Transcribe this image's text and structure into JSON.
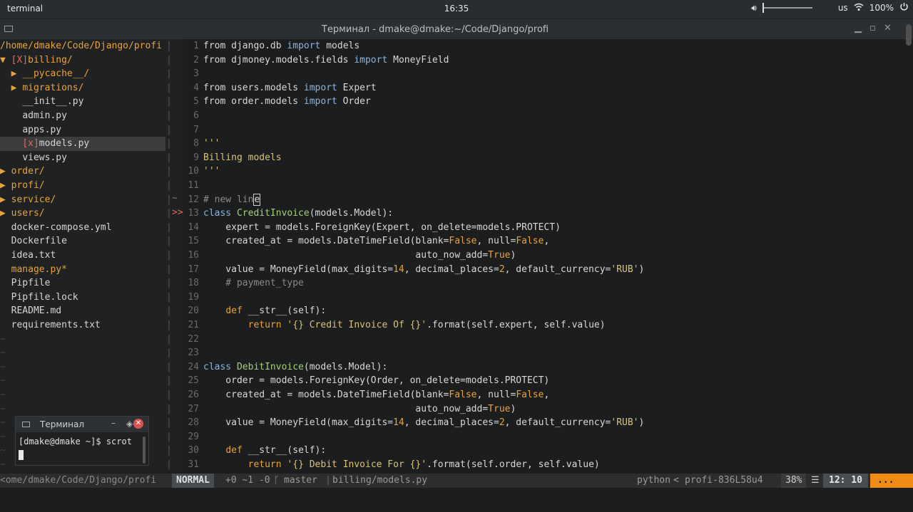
{
  "topbar": {
    "app_name": "terminal",
    "clock": "16:35",
    "keyboard_layout": "us",
    "battery": "100%",
    "volume_level": 0.0
  },
  "window": {
    "title": "Терминал - dmake@dmake:~/Code/Django/profi"
  },
  "tree": {
    "root": "/home/dmake/Code/Django/profi",
    "entries": [
      {
        "indent": "",
        "arrow": "▼ ",
        "mark": "[X]",
        "name": "billing/",
        "kind": "dir"
      },
      {
        "indent": "  ",
        "arrow": "▶ ",
        "mark": "",
        "name": "__pycache__/",
        "kind": "dir"
      },
      {
        "indent": "  ",
        "arrow": "▶ ",
        "mark": "",
        "name": "migrations/",
        "kind": "dir"
      },
      {
        "indent": "    ",
        "arrow": "",
        "mark": "",
        "name": "__init__.py",
        "kind": "file"
      },
      {
        "indent": "    ",
        "arrow": "",
        "mark": "",
        "name": "admin.py",
        "kind": "file"
      },
      {
        "indent": "    ",
        "arrow": "",
        "mark": "",
        "name": "apps.py",
        "kind": "file"
      },
      {
        "indent": "    ",
        "arrow": "",
        "mark": "[x]",
        "name": "models.py",
        "kind": "file",
        "selected": true
      },
      {
        "indent": "    ",
        "arrow": "",
        "mark": "",
        "name": "views.py",
        "kind": "file"
      },
      {
        "indent": "",
        "arrow": "▶ ",
        "mark": "",
        "name": "order/",
        "kind": "dir"
      },
      {
        "indent": "",
        "arrow": "▶ ",
        "mark": "",
        "name": "profi/",
        "kind": "dir"
      },
      {
        "indent": "",
        "arrow": "▶ ",
        "mark": "",
        "name": "service/",
        "kind": "dir"
      },
      {
        "indent": "",
        "arrow": "▶ ",
        "mark": "",
        "name": "users/",
        "kind": "dir"
      },
      {
        "indent": "  ",
        "arrow": "",
        "mark": "",
        "name": "docker-compose.yml",
        "kind": "file"
      },
      {
        "indent": "  ",
        "arrow": "",
        "mark": "",
        "name": "Dockerfile",
        "kind": "file"
      },
      {
        "indent": "  ",
        "arrow": "",
        "mark": "",
        "name": "idea.txt",
        "kind": "file"
      },
      {
        "indent": "  ",
        "arrow": "",
        "mark": "",
        "name": "manage.py*",
        "kind": "mod"
      },
      {
        "indent": "  ",
        "arrow": "",
        "mark": "",
        "name": "Pipfile",
        "kind": "file"
      },
      {
        "indent": "  ",
        "arrow": "",
        "mark": "",
        "name": "Pipfile.lock",
        "kind": "file"
      },
      {
        "indent": "  ",
        "arrow": "",
        "mark": "",
        "name": "README.md",
        "kind": "file"
      },
      {
        "indent": "  ",
        "arrow": "",
        "mark": "",
        "name": "requirements.txt",
        "kind": "file"
      }
    ],
    "empty_marker": "~",
    "separator": "|"
  },
  "gutter": {
    "tilde": "~",
    "sign": ">>"
  },
  "code": [
    [
      [
        "from ",
        ""
      ],
      [
        "django.db ",
        ""
      ],
      [
        "import",
        "kw"
      ],
      [
        " models",
        ""
      ]
    ],
    [
      [
        "from ",
        ""
      ],
      [
        "djmoney.models.fields ",
        ""
      ],
      [
        "import",
        "kw"
      ],
      [
        " MoneyField",
        ""
      ]
    ],
    [],
    [
      [
        "from ",
        ""
      ],
      [
        "users.models ",
        ""
      ],
      [
        "import",
        "kw"
      ],
      [
        " Expert",
        ""
      ]
    ],
    [
      [
        "from ",
        ""
      ],
      [
        "order.models ",
        ""
      ],
      [
        "import",
        "kw"
      ],
      [
        " Order",
        ""
      ]
    ],
    [],
    [],
    [
      [
        "'''",
        "str"
      ]
    ],
    [
      [
        "Billing models",
        "str"
      ]
    ],
    [
      [
        "'''",
        "str"
      ]
    ],
    [],
    [
      [
        "# new lin",
        "com"
      ],
      [
        "e",
        "cursor"
      ]
    ],
    [
      [
        "class",
        "kw"
      ],
      [
        " ",
        ""
      ],
      [
        "CreditInvoice",
        "cls"
      ],
      [
        "(models.Model):",
        ""
      ]
    ],
    [
      [
        "    expert = models.ForeignKey(Expert, on_delete=models.PROTECT)",
        ""
      ]
    ],
    [
      [
        "    created_at = models.DateTimeField(blank=",
        ""
      ],
      [
        "False",
        "kw2"
      ],
      [
        ", null=",
        ""
      ],
      [
        "False",
        "kw2"
      ],
      [
        ",",
        ""
      ]
    ],
    [
      [
        "                                      auto_now_add=",
        ""
      ],
      [
        "True",
        "kw2"
      ],
      [
        ")",
        ""
      ]
    ],
    [
      [
        "    value = MoneyField(max_digits=",
        ""
      ],
      [
        "14",
        "num"
      ],
      [
        ", decimal_places=",
        ""
      ],
      [
        "2",
        "num"
      ],
      [
        ", default_currency=",
        ""
      ],
      [
        "'RUB'",
        "str"
      ],
      [
        ")",
        ""
      ]
    ],
    [
      [
        "    # payment_type",
        "com"
      ]
    ],
    [],
    [
      [
        "    ",
        ""
      ],
      [
        "def",
        "kw2"
      ],
      [
        " __str__(self):",
        ""
      ]
    ],
    [
      [
        "        ",
        ""
      ],
      [
        "return",
        "kw2"
      ],
      [
        " ",
        ""
      ],
      [
        "'{} Credit Invoice Of {}'",
        "str"
      ],
      [
        ".format(self.expert, self.value)",
        ""
      ]
    ],
    [],
    [],
    [
      [
        "class",
        "kw"
      ],
      [
        " ",
        ""
      ],
      [
        "DebitInvoice",
        "cls"
      ],
      [
        "(models.Model):",
        ""
      ]
    ],
    [
      [
        "    order = models.ForeignKey(Order, on_delete=models.PROTECT)",
        ""
      ]
    ],
    [
      [
        "    created_at = models.DateTimeField(blank=",
        ""
      ],
      [
        "False",
        "kw2"
      ],
      [
        ", null=",
        ""
      ],
      [
        "False",
        "kw2"
      ],
      [
        ",",
        ""
      ]
    ],
    [
      [
        "                                      auto_now_add=",
        ""
      ],
      [
        "True",
        "kw2"
      ],
      [
        ")",
        ""
      ]
    ],
    [
      [
        "    value = MoneyField(max_digits=",
        ""
      ],
      [
        "14",
        "num"
      ],
      [
        ", decimal_places=",
        ""
      ],
      [
        "2",
        "num"
      ],
      [
        ", default_currency=",
        ""
      ],
      [
        "'RUB'",
        "str"
      ],
      [
        ")",
        ""
      ]
    ],
    [],
    [
      [
        "    ",
        ""
      ],
      [
        "def",
        "kw2"
      ],
      [
        " __str__(self):",
        ""
      ]
    ],
    [
      [
        "        ",
        ""
      ],
      [
        "return",
        "kw2"
      ],
      [
        " ",
        ""
      ],
      [
        "'{} Debit Invoice For {}'",
        "str"
      ],
      [
        ".format(self.order, self.value)",
        ""
      ]
    ]
  ],
  "status": {
    "left_path": "<ome/dmake/Code/Django/profi",
    "mode": "NORMAL",
    "diff": "+0 ~1 -0",
    "branch_icon": "ᚴ",
    "branch": "master",
    "file": "billing/models.py",
    "filetype": "python",
    "venv": "profi-836L58u4",
    "percent": "38%",
    "menu_icon": "☰",
    "position": "12: 10",
    "extra": "..."
  },
  "popup": {
    "title": "Терминал",
    "prompt": "[dmake@dmake ~]$ scrot"
  },
  "colors": {
    "accent": "#f08c16",
    "directory": "#e8a33a",
    "keyword": "#8fb3d8",
    "string": "#d8c27a",
    "class_name": "#a6cf7a"
  }
}
